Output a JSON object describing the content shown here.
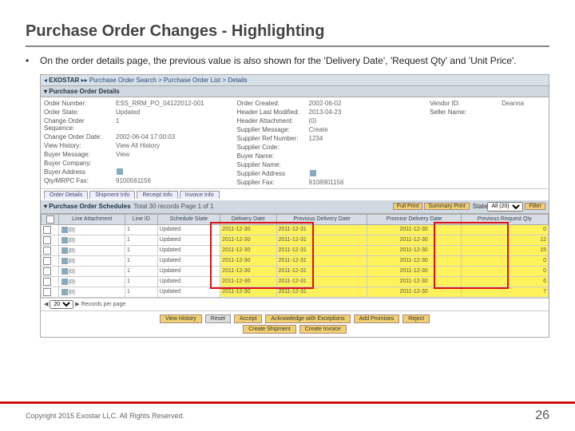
{
  "title": "Purchase Order Changes - Highlighting",
  "bullet": "On the order details page, the previous value is also shown for the 'Delivery Date', 'Request Qty' and 'Unit Price'.",
  "breadcrumb": {
    "brand": "EXOSTAR",
    "path": "Purchase Order Search > Purchase Order List > Details"
  },
  "section1": "Purchase Order Details",
  "left": [
    {
      "k": "Order Number:",
      "v": "ESS_RRM_PO_04122012-001"
    },
    {
      "k": "Order State:",
      "v": "Updated"
    },
    {
      "k": "Change Order Sequence:",
      "v": "1"
    },
    {
      "k": "Change Order Date:",
      "v": "2002-06-04 17:00:03"
    },
    {
      "k": "View History:",
      "v": "View All History",
      "link": true
    },
    {
      "k": "Buyer Message:",
      "v": "View",
      "link": true
    },
    {
      "k": "Buyer Company:",
      "v": ""
    },
    {
      "k": "Buyer Address",
      "v": ""
    },
    {
      "k": "Qty/MRPC Fax:",
      "v": "9100561156"
    }
  ],
  "right": [
    {
      "k": "Order Created:",
      "v": "2002-06-02"
    },
    {
      "k": "Header Last Modified:",
      "v": "2013-04-23"
    },
    {
      "k": "Header Attachment:",
      "v": "(0)"
    },
    {
      "k": "Supplier Message:",
      "v": "Create",
      "link": true
    },
    {
      "k": "Supplier Ref Number:",
      "v": "1234"
    },
    {
      "k": "Supplier Code:",
      "v": ""
    },
    {
      "k": "Buyer Name:",
      "v": ""
    },
    {
      "k": "Supplier Name:",
      "v": ""
    },
    {
      "k": "Supplier Address",
      "v": ""
    },
    {
      "k": "Supplier Fax:",
      "v": "9108901156"
    }
  ],
  "right2": [
    {
      "k": "Vendor ID:",
      "v": "Deanna"
    },
    {
      "k": "Seller Name:",
      "v": ""
    }
  ],
  "tabs": [
    "Order Details",
    "Shipment Info",
    "Receipt Info",
    "Invoice Info"
  ],
  "sched": {
    "title": "Purchase Order Schedules",
    "meta": "Total 30 records Page 1 of 1",
    "btns": [
      "Full Print",
      "Summary Print"
    ],
    "stateLabel": "State",
    "allLabel": "All (20)",
    "filter": "Filter"
  },
  "cols": [
    "",
    "Line Attachment",
    "Line ID",
    "Schedule State",
    "Delivery Date",
    "Previous Delivery Date",
    "Promise Delivery Date",
    "Previous Request Qty"
  ],
  "rows": [
    {
      "la": "(0)",
      "id": "1",
      "st": "Updated",
      "dd": "2011-12-30",
      "pdd": "2011-12-31",
      "prd": "2011-12-30",
      "prq": "0"
    },
    {
      "la": "(0)",
      "id": "1",
      "st": "Updated",
      "dd": "2011-12-30",
      "pdd": "2011-12-31",
      "prd": "2011-12-30",
      "prq": "12"
    },
    {
      "la": "(0)",
      "id": "1",
      "st": "Updated",
      "dd": "2011-12-30",
      "pdd": "2011-12-31",
      "prd": "2011-12-30",
      "prq": "15"
    },
    {
      "la": "(0)",
      "id": "1",
      "st": "Updated",
      "dd": "2011-12-30",
      "pdd": "2011-12-31",
      "prd": "2011-12-30",
      "prq": "0"
    },
    {
      "la": "(0)",
      "id": "1",
      "st": "Updated",
      "dd": "2011-12-30",
      "pdd": "2011-12-31",
      "prd": "2011-12-30",
      "prq": "0"
    },
    {
      "la": "(0)",
      "id": "1",
      "st": "Updated",
      "dd": "2011-12-30",
      "pdd": "2011-12-31",
      "prd": "2011-12-30",
      "prq": "6"
    },
    {
      "la": "(0)",
      "id": "1",
      "st": "Updated",
      "dd": "2011-12-30",
      "pdd": "2011-12-31",
      "prd": "2011-12-30",
      "prq": "7"
    }
  ],
  "pager": {
    "perpage": "20",
    "label": "Records per page"
  },
  "actions": [
    "View History",
    "Reset",
    "Accept",
    "Acknowledge with Exceptions",
    "Add Promises",
    "Reject",
    "Create Shipment",
    "Create Invoice"
  ],
  "copyright": "Copyright 2015 Exostar LLC. All Rights Reserved.",
  "page": "26"
}
